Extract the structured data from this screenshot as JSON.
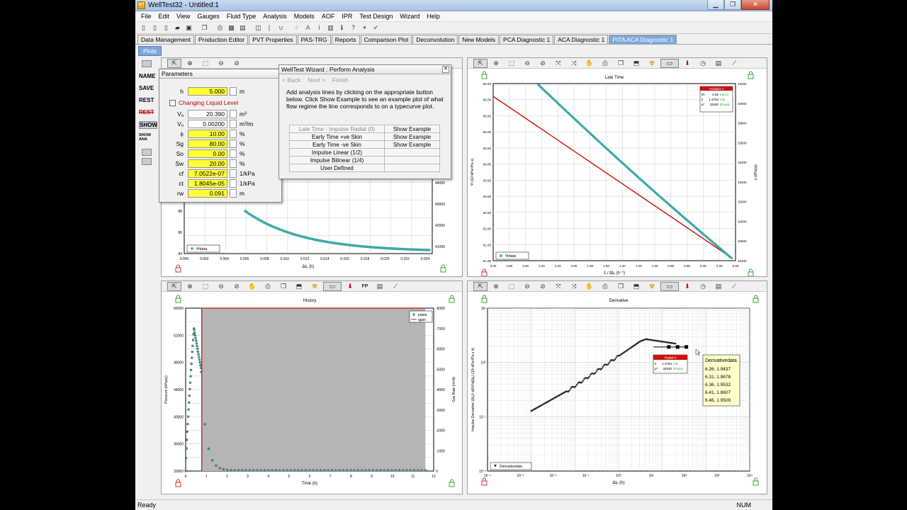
{
  "window": {
    "title": "WellTest32 - Untitled:1",
    "app_icon": "WT"
  },
  "menu": [
    "File",
    "Edit",
    "View",
    "Gauges",
    "Fluid Type",
    "Analysis",
    "Models",
    "AOF",
    "IPR",
    "Test Design",
    "Wizard",
    "Help"
  ],
  "main_tabs": [
    "Data Management",
    "Production Editor",
    "PVT Properties",
    "PAS-TRG",
    "Reports",
    "Comparison Plot",
    "Deconvolution",
    "New Models",
    "PCA Diagnostic 1",
    "ACA Diagnostic 1",
    "PITA ACA Diagnostic 1"
  ],
  "active_tab": "PITA ACA Diagnostic 1",
  "sub_tab": "Plots",
  "left_buttons": [
    "NAME",
    "SAVE",
    "REST",
    "REST",
    "SHOW",
    "SHOW ANA"
  ],
  "parameters": {
    "title": "Parameters",
    "changing_liquid_level": "Changing Liquid Level",
    "rows": [
      {
        "label": "h",
        "value": "5.000",
        "unit": "m",
        "yellow": true
      },
      {
        "label": "Vₐ",
        "value": "20.390",
        "unit": "m³",
        "yellow": false
      },
      {
        "label": "Vᵤ",
        "value": "0.00200",
        "unit": "m³/m",
        "yellow": false
      },
      {
        "label": "ϕ",
        "value": "10.00",
        "unit": "%",
        "yellow": true
      },
      {
        "label": "Sg",
        "value": "80.00",
        "unit": "%",
        "yellow": true
      },
      {
        "label": "So",
        "value": "0.00",
        "unit": "%",
        "yellow": true
      },
      {
        "label": "Sw",
        "value": "20.00",
        "unit": "%",
        "yellow": true
      },
      {
        "label": "cf",
        "value": "7.0522e-07",
        "unit": "1/kPa",
        "yellow": true
      },
      {
        "label": "ct",
        "value": "1.8045e-05",
        "unit": "1/kPa",
        "yellow": true
      },
      {
        "label": "rw",
        "value": "0.091",
        "unit": "m",
        "yellow": true
      }
    ]
  },
  "wizard": {
    "title": "WellTest Wizard : Perform Analysis",
    "back": "< Back",
    "next": "Next >",
    "finish": "Finish",
    "instructions": "Add analysis lines by clicking on the appropriate button below.  Click Show Example to see an example plot of what flow regime the line corresponds to on a typecurve plot.",
    "lines": [
      {
        "label": "Late Time - Impulse Radial (0)",
        "example": "Show Example",
        "dim": true
      },
      {
        "label": "Early Time +ve Skin",
        "example": "Show Example",
        "dim": false
      },
      {
        "label": "Early Time -ve Skin",
        "example": "Show Example",
        "dim": false
      },
      {
        "label": "Impulse Linear (1/2)",
        "example": "",
        "dim": false
      },
      {
        "label": "Impulse Bilinear (1/4)",
        "example": "",
        "dim": false
      },
      {
        "label": "User Defined",
        "example": "",
        "dim": false
      }
    ]
  },
  "panel_tl": {
    "legend": "Ψdata",
    "xlabel": "Δtₑ (h)",
    "xticks": [
      "0.000",
      "0.002",
      "0.004",
      "0.006",
      "0.008",
      "0.010",
      "0.012",
      "0.014",
      "0.016",
      "0.018",
      "0.020",
      "0.022",
      "0.024"
    ],
    "yticks": [
      "84",
      "86",
      "88"
    ],
    "y2ticks": [
      "41000",
      "42000",
      "43000",
      "44000"
    ]
  },
  "panel_tr": {
    "title": "Late Time",
    "xlabel": "1 / Δtₑ (h⁻¹)",
    "ylabel": "Ψ (10⁹kPa²/Pa.s)",
    "y2label": "p (kPa(a))",
    "legend": "Ψdata",
    "xticks": [
      "3.00",
      "2.80",
      "2.60",
      "2.40",
      "2.20",
      "2.00",
      "1.80",
      "1.60",
      "1.40",
      "1.20",
      "1.00",
      "0.80",
      "0.60",
      "0.40",
      "0.20",
      "0.00"
    ],
    "yticks": [
      "61.00",
      "61.50",
      "62.00",
      "62.50",
      "63.00",
      "63.50",
      "64.00",
      "64.50",
      "65.00",
      "65.50",
      "66.00",
      "66.50"
    ],
    "y2ticks": [
      "32400",
      "32600",
      "32800",
      "33000",
      "33200",
      "33400",
      "33600",
      "33800",
      "34000",
      "34200"
    ],
    "box": {
      "title": "Analysis 1",
      "rows": [
        [
          "kh",
          "6.86",
          "mD.m"
        ],
        [
          "k",
          "1.3763",
          "mD"
        ],
        [
          "p*",
          "32930",
          "kPa(a)"
        ]
      ]
    }
  },
  "panel_bl": {
    "title": "History",
    "xlabel": "Time (h)",
    "ylabel": "Pressure (kPa(a))",
    "y2label": "Gas Rate (m³/d)",
    "legend": [
      "pdata",
      "qgas"
    ],
    "xticks": [
      "0",
      "1",
      "2",
      "3",
      "4",
      "5",
      "6",
      "7",
      "8",
      "9",
      "10",
      "11",
      "12"
    ],
    "yticks": [
      "32000",
      "36000",
      "40000",
      "44000",
      "48000",
      "52000",
      "56000"
    ],
    "y2ticks": [
      "0",
      "-1000",
      "-2000",
      "-3000",
      "-4000",
      "-5000",
      "-6000",
      "-7000",
      "-8000"
    ]
  },
  "panel_br": {
    "title": "Derivative",
    "xlabel": "Δtₑ (h)",
    "ylabel": "Impulse Derivative (Δtₑ)² dΔΨ/d(Δtₑ) (10⁹kPa²/Pa.s h)",
    "legend": "Derivativedata",
    "xticks": [
      "10⁻⁴",
      "10⁻³",
      "10⁻²",
      "10⁻¹",
      "10⁰",
      "10¹",
      "10²",
      "10³",
      "10⁴"
    ],
    "yticks": [
      "10⁻²",
      "10⁻¹",
      "10⁰",
      "10¹"
    ],
    "box": {
      "title": "Radial 0",
      "rows": [
        [
          "k",
          "1.3763",
          "mD"
        ],
        [
          "p*",
          "32930",
          "kPa(a)"
        ]
      ]
    },
    "tooltip": {
      "title": "Derivativedata",
      "rows": [
        "6.26, 1.9437",
        "6.31, 1.9878",
        "6.36, 1.9532",
        "6.41, 1.8607",
        "6.46, 1.9509"
      ]
    }
  },
  "colors": {
    "teal": "#3fbfbf",
    "red": "#cc1111",
    "tab_active": "#7fa7d9",
    "yellow": "#ffff33"
  },
  "status": {
    "left": "Ready",
    "right": "NUM"
  }
}
